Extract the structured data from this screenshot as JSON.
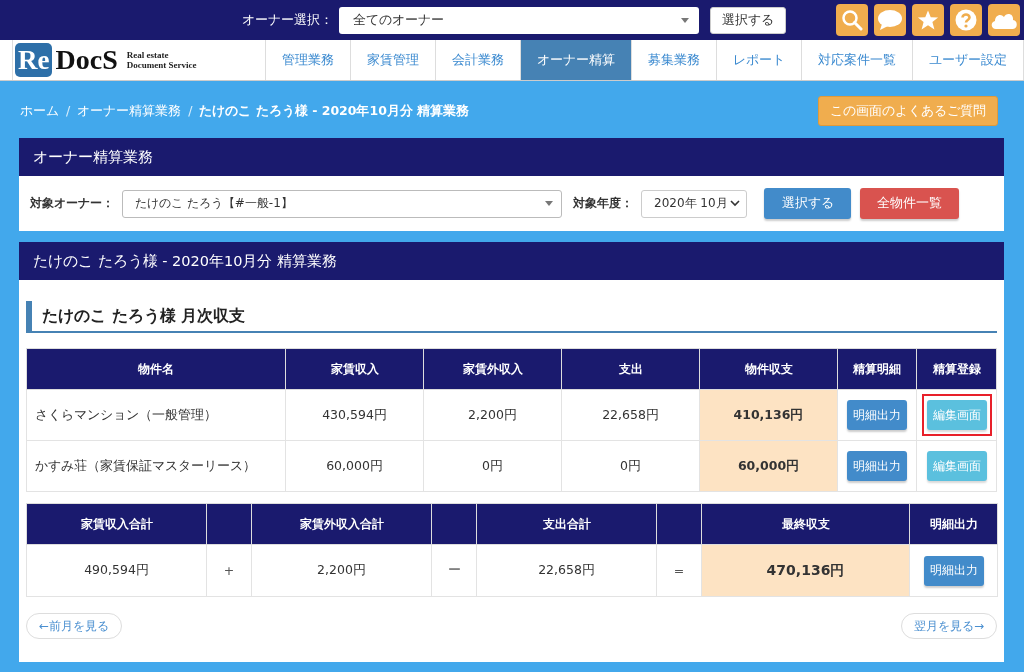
{
  "top_bar": {
    "owner_select_label": "オーナー選択：",
    "owner_select_value": "全てのオーナー",
    "select_button": "選択する"
  },
  "logo": {
    "mark": "Re",
    "name": "DocS",
    "tagline": [
      "Real estate",
      "Document Service"
    ]
  },
  "tabs": [
    {
      "label": "管理業務",
      "selected": false
    },
    {
      "label": "家賃管理",
      "selected": false
    },
    {
      "label": "会計業務",
      "selected": false
    },
    {
      "label": "オーナー精算",
      "selected": true
    },
    {
      "label": "募集業務",
      "selected": false
    },
    {
      "label": "レポート",
      "selected": false
    },
    {
      "label": "対応案件一覧",
      "selected": false
    },
    {
      "label": "ユーザー設定",
      "selected": false
    }
  ],
  "breadcrumb_separator": "/",
  "breadcrumb": [
    {
      "label": "ホーム",
      "current": false
    },
    {
      "label": "オーナー精算業務",
      "current": false
    },
    {
      "label": "たけのこ たろう様 - 2020年10月分 精算業務",
      "current": true
    }
  ],
  "faq_button": "この画面のよくあるご質問",
  "filter_panel": {
    "title": "オーナー精算業務",
    "owner_label": "対象オーナー：",
    "owner_value": "たけのこ たろう【#一般-1】",
    "year_label": "対象年度：",
    "year_value": "2020年 10月",
    "select_button": "選択する",
    "all_properties_button": "全物件一覧"
  },
  "settlement_panel": {
    "title": "たけのこ たろう様 - 2020年10月分 精算業務",
    "section_heading": "たけのこ たろう様 月次収支",
    "columns": [
      "物件名",
      "家賃収入",
      "家賃外収入",
      "支出",
      "物件収支",
      "精算明細",
      "精算登録"
    ],
    "rows": [
      {
        "name": "さくらマンション（一般管理）",
        "rent": "430,594円",
        "other_income": "2,200円",
        "expense": "22,658円",
        "balance": "410,136円",
        "detail_button": "明細出力",
        "edit_button": "編集画面",
        "highlighted": true
      },
      {
        "name": "かすみ荘（家賃保証マスターリース）",
        "rent": "60,000円",
        "other_income": "0円",
        "expense": "0円",
        "balance": "60,000円",
        "detail_button": "明細出力",
        "edit_button": "編集画面",
        "highlighted": false
      }
    ],
    "summary": [
      {
        "kind": "value",
        "heading": "家賃収入合計",
        "value": "490,594円"
      },
      {
        "kind": "operator",
        "value": "+"
      },
      {
        "kind": "value",
        "heading": "家賃外収入合計",
        "value": "2,200円"
      },
      {
        "kind": "operator",
        "value": "ー"
      },
      {
        "kind": "value",
        "heading": "支出合計",
        "value": "22,658円"
      },
      {
        "kind": "operator",
        "value": "="
      },
      {
        "kind": "total",
        "heading": "最終収支",
        "value": "470,136円"
      },
      {
        "kind": "button",
        "heading": "明細出力",
        "value": "明細出力"
      }
    ],
    "prev_button": "←前月を見る",
    "next_button": "翌月を見る→"
  }
}
